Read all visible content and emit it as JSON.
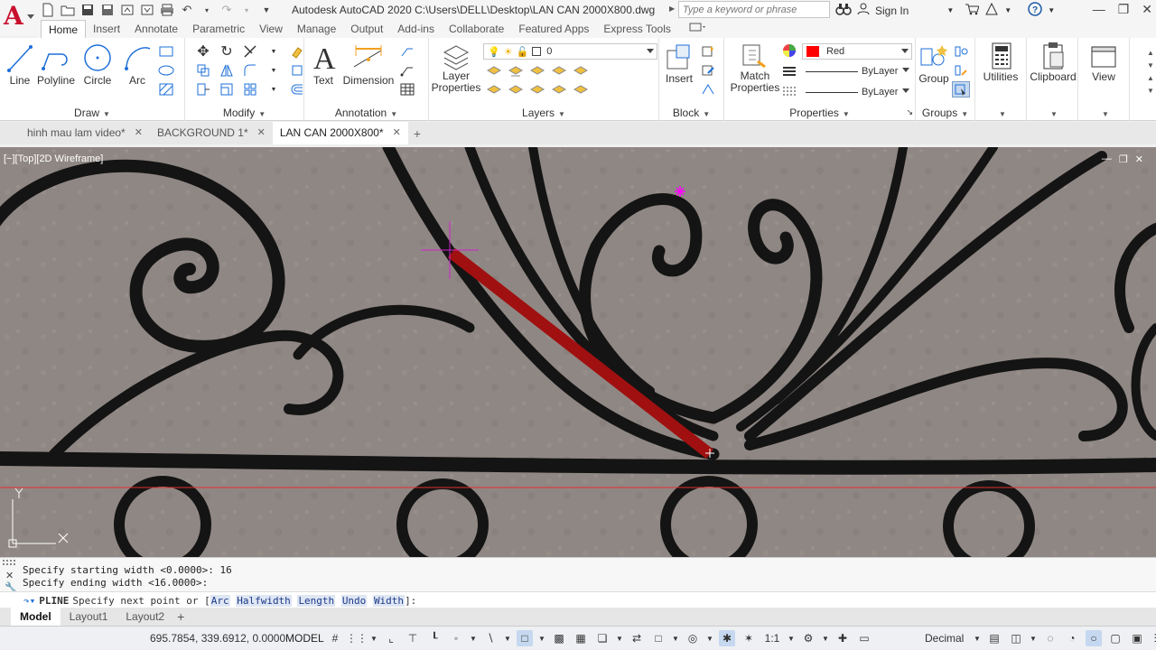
{
  "app": {
    "logo_letter": "A",
    "title": "Autodesk AutoCAD 2020    C:\\Users\\DELL\\Desktop\\LAN CAN 2000X800.dwg",
    "search_placeholder": "Type a keyword or phrase",
    "signin_label": "Sign In"
  },
  "ribbon_tabs": [
    "Home",
    "Insert",
    "Annotate",
    "Parametric",
    "View",
    "Manage",
    "Output",
    "Add-ins",
    "Collaborate",
    "Featured Apps",
    "Express Tools"
  ],
  "active_ribbon_tab": "Home",
  "draw_panel": {
    "title": "Draw",
    "tools": [
      "Line",
      "Polyline",
      "Circle",
      "Arc"
    ]
  },
  "modify_panel": {
    "title": "Modify"
  },
  "annotation_panel": {
    "title": "Annotation",
    "tools": [
      "Text",
      "Dimension"
    ]
  },
  "layers_panel": {
    "title": "Layers",
    "layer_properties": "Layer\nProperties",
    "layer_properties_l1": "Layer",
    "layer_properties_l2": "Properties",
    "current_layer": "0"
  },
  "block_panel": {
    "title": "Block",
    "insert_label": "Insert"
  },
  "properties_panel": {
    "title": "Properties",
    "match_l1": "Match",
    "match_l2": "Properties",
    "color_value": "Red",
    "color_hex": "#ff0000",
    "linetype_value": "ByLayer",
    "lineweight_value": "ByLayer"
  },
  "groups_panel": {
    "title": "Groups",
    "group_label": "Group"
  },
  "utilities_label": "Utilities",
  "clipboard_label": "Clipboard",
  "view_label": "View",
  "file_tabs": [
    {
      "label": "hinh mau lam video*",
      "active": false
    },
    {
      "label": "BACKGROUND 1*",
      "active": false
    },
    {
      "label": "LAN CAN 2000X800*",
      "active": true
    }
  ],
  "viewport_label": "[−][Top][2D Wireframe]",
  "command_history": [
    "Specify starting width <0.0000>: 16",
    "Specify ending width <16.0000>:"
  ],
  "command_prompt": {
    "command": "PLINE",
    "text": "Specify next point or [",
    "options": [
      "Arc",
      "Halfwidth",
      "Length",
      "Undo",
      "Width"
    ],
    "suffix": "]:"
  },
  "layout_tabs": [
    "Model",
    "Layout1",
    "Layout2"
  ],
  "active_layout_tab": "Model",
  "status": {
    "coordinates": "695.7854, 339.6912, 0.0000",
    "space": "MODEL",
    "scale": "1:1",
    "units": "Decimal"
  },
  "colors": {
    "accent_red": "#c8102e",
    "pline_color": "#a01010",
    "crosshair": "#d020d0"
  }
}
